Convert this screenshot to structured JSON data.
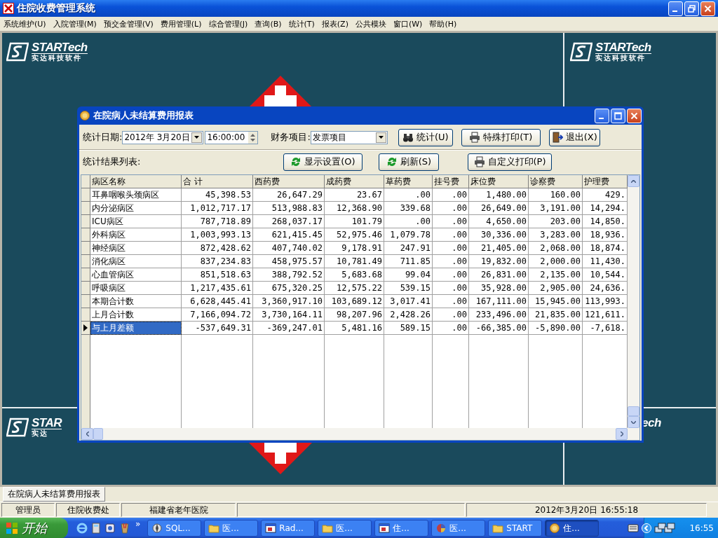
{
  "app": {
    "title": "住院收费管理系统"
  },
  "menu": [
    {
      "label": "系统维护(U)"
    },
    {
      "label": "入院管理(M)"
    },
    {
      "label": "预交金管理(V)"
    },
    {
      "label": "费用管理(L)"
    },
    {
      "label": "综合管理(J)"
    },
    {
      "label": "查询(B)"
    },
    {
      "label": "统计(T)"
    },
    {
      "label": "报表(Z)"
    },
    {
      "label": "公共模块"
    },
    {
      "label": "窗口(W)"
    },
    {
      "label": "帮助(H)"
    }
  ],
  "backdrop": {
    "logos": [
      {
        "brand": "STARTech",
        "tagline": "实达科技软件"
      },
      {
        "brand": "STARTech",
        "tagline": "实达科技软件"
      },
      {
        "brand": "STAR",
        "tagline": "实达"
      },
      {
        "brand": "ech"
      }
    ]
  },
  "dialog": {
    "title": "在院病人未结算费用报表",
    "date_label": "统计日期:",
    "date": "2012年  3月20日",
    "time": "16:00:00",
    "item_label": "财务项目:",
    "item": "发票项目",
    "buttons": [
      {
        "label": "统计(U)",
        "kind": "binoculars"
      },
      {
        "label": "特殊打印(T)",
        "kind": "printer"
      },
      {
        "label": "退出(X)",
        "kind": "exit"
      }
    ],
    "list_label": "统计结果列表:",
    "list_buttons": [
      {
        "label": "显示设置(O)",
        "kind": "refresh"
      },
      {
        "label": "刷新(S)",
        "kind": "refresh"
      },
      {
        "label": "自定义打印(P)",
        "kind": "printer"
      }
    ],
    "table": {
      "columns": [
        "病区名称",
        "合 计",
        "西药费",
        "成药费",
        "草药费",
        "挂号费",
        "床位费",
        "诊察费",
        "护理费"
      ],
      "rows": [
        {
          "selected": false,
          "cells": [
            "耳鼻咽喉头颈病区",
            "45,398.53",
            "26,647.29",
            "23.67",
            ".00",
            ".00",
            "1,480.00",
            "160.00",
            "429."
          ]
        },
        {
          "selected": false,
          "cells": [
            "内分泌病区",
            "1,012,717.17",
            "513,988.83",
            "12,368.90",
            "339.68",
            ".00",
            "26,649.00",
            "3,191.00",
            "14,294."
          ]
        },
        {
          "selected": false,
          "cells": [
            "ICU病区",
            "787,718.89",
            "268,037.17",
            "101.79",
            ".00",
            ".00",
            "4,650.00",
            "203.00",
            "14,850."
          ]
        },
        {
          "selected": false,
          "cells": [
            "外科病区",
            "1,003,993.13",
            "621,415.45",
            "52,975.46",
            "1,079.78",
            ".00",
            "30,336.00",
            "3,283.00",
            "18,936."
          ]
        },
        {
          "selected": false,
          "cells": [
            "神经病区",
            "872,428.62",
            "407,740.02",
            "9,178.91",
            "247.91",
            ".00",
            "21,405.00",
            "2,068.00",
            "18,874."
          ]
        },
        {
          "selected": false,
          "cells": [
            "消化病区",
            "837,234.83",
            "458,975.57",
            "10,781.49",
            "711.85",
            ".00",
            "19,832.00",
            "2,000.00",
            "11,430."
          ]
        },
        {
          "selected": false,
          "cells": [
            "心血管病区",
            "851,518.63",
            "388,792.52",
            "5,683.68",
            "99.04",
            ".00",
            "26,831.00",
            "2,135.00",
            "10,544."
          ]
        },
        {
          "selected": false,
          "cells": [
            "呼吸病区",
            "1,217,435.61",
            "675,320.25",
            "12,575.22",
            "539.15",
            ".00",
            "35,928.00",
            "2,905.00",
            "24,636."
          ]
        },
        {
          "selected": false,
          "cells": [
            "本期合计数",
            "6,628,445.41",
            "3,360,917.10",
            "103,689.12",
            "3,017.41",
            ".00",
            "167,111.00",
            "15,945.00",
            "113,993."
          ]
        },
        {
          "selected": false,
          "cells": [
            "上月合计数",
            "7,166,094.72",
            "3,730,164.11",
            "98,207.96",
            "2,428.26",
            ".00",
            "233,496.00",
            "21,835.00",
            "121,611."
          ]
        },
        {
          "selected": true,
          "cells": [
            "与上月差额",
            "-537,649.31",
            "-369,247.01",
            "5,481.16",
            "589.15",
            ".00",
            "-66,385.00",
            "-5,890.00",
            "-7,618."
          ]
        }
      ]
    }
  },
  "mdi_tabs": [
    {
      "label": "在院病人未结算费用报表",
      "selected": true
    }
  ],
  "status_bar": {
    "user": "管理员",
    "department": "住院收费处",
    "hospital": "福建省老年医院",
    "datetime": "2012年3月20日  16:55:18"
  },
  "taskbar": {
    "start": "开始",
    "more": "»",
    "tasks": [
      {
        "label": "SQL...",
        "kind": "compass",
        "selected": false
      },
      {
        "label": "医...",
        "kind": "folder",
        "selected": false
      },
      {
        "label": "Rad...",
        "kind": "app",
        "selected": false
      },
      {
        "label": "医...",
        "kind": "folder",
        "selected": false
      },
      {
        "label": "住...",
        "kind": "app",
        "selected": false
      },
      {
        "label": "医...",
        "kind": "disc",
        "selected": false
      },
      {
        "label": "START",
        "kind": "folder",
        "selected": false
      },
      {
        "label": "住...",
        "kind": "coin",
        "selected": true
      }
    ],
    "clock": "16:55"
  }
}
